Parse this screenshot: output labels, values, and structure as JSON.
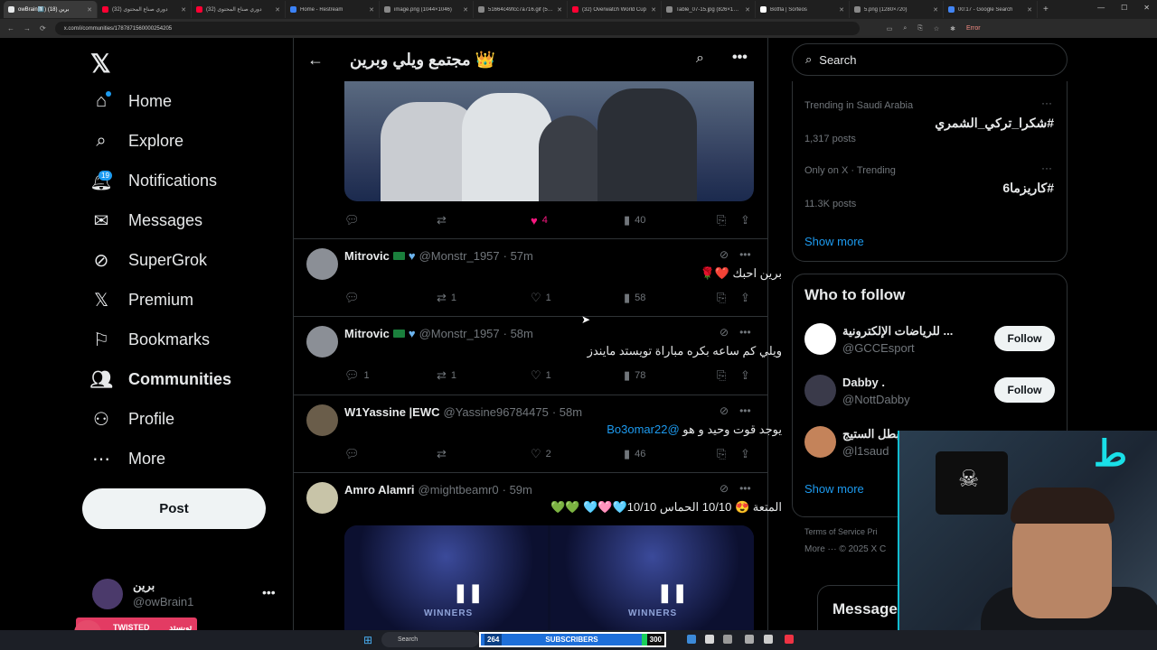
{
  "browser": {
    "tabs": [
      {
        "title": "owBrain1️⃣) برين (18)",
        "active": true,
        "color": "#e7e9ea"
      },
      {
        "title": "(32) دوري صناع المحتوى",
        "active": false,
        "color": "#ff0033"
      },
      {
        "title": "(32) دوري صناع المحتوى",
        "active": false,
        "color": "#ff0033"
      },
      {
        "title": "Home - Restream",
        "active": false,
        "color": "#3b82f6"
      },
      {
        "title": "image.png (1044×1046)",
        "active": false,
        "color": "#888888"
      },
      {
        "title": "51664c49fcc7a716.gif (51...",
        "active": false,
        "color": "#888888"
      },
      {
        "title": "(32) Overwatch World Cup",
        "active": false,
        "color": "#ff0033"
      },
      {
        "title": "Table_07-15.jpg (826×104...",
        "active": false,
        "color": "#888888"
      },
      {
        "title": "Botfla | Sorteos",
        "active": false,
        "color": "#ffffff"
      },
      {
        "title": "5.png (1280×720)",
        "active": false,
        "color": "#888888"
      },
      {
        "title": "00:17 - Google Search",
        "active": false,
        "color": "#4285f4"
      }
    ],
    "url": "x.com/i/communities/1787871560000254205",
    "profile_label": "Error"
  },
  "nav": {
    "items": [
      {
        "label": "Home",
        "icon": "home-icon"
      },
      {
        "label": "Explore",
        "icon": "search-icon"
      },
      {
        "label": "Notifications",
        "icon": "bell-icon"
      },
      {
        "label": "Messages",
        "icon": "envelope-icon"
      },
      {
        "label": "SuperGrok",
        "icon": "grok-icon"
      },
      {
        "label": "Premium",
        "icon": "x-icon"
      },
      {
        "label": "Bookmarks",
        "icon": "bookmark-icon"
      },
      {
        "label": "Communities",
        "icon": "people-icon"
      },
      {
        "label": "Profile",
        "icon": "person-icon"
      },
      {
        "label": "More",
        "icon": "more-circle-icon"
      }
    ],
    "notifications_badge": "19",
    "post_label": "Post",
    "account": {
      "name": "برين",
      "handle": "@owBrain1"
    }
  },
  "community": {
    "title": "مجتمع ويلي وبرين 👑"
  },
  "post0_actions": {
    "replies": "",
    "reposts": "",
    "likes": "4",
    "views": "40"
  },
  "posts": [
    {
      "name": "Mitrovic",
      "handle": "@Monstr_1957",
      "time": "· 57m",
      "text": "برين احبك ❤️🌹",
      "link": "",
      "replies": "",
      "reposts": "1",
      "likes": "1",
      "views": "58"
    },
    {
      "name": "Mitrovic",
      "handle": "@Monstr_1957",
      "time": "· 58m",
      "text": "ويلي كم ساعه بكره مباراة تويستد مايندز",
      "link": "",
      "replies": "1",
      "reposts": "1",
      "likes": "1",
      "views": "78"
    },
    {
      "name": "W1Yassine |EWC",
      "handle": "@Yassine96784475",
      "time": "· 58m",
      "text": "يوجد قوت وحيد و هو",
      "link": "@Bo3omar22",
      "replies": "",
      "reposts": "",
      "likes": "2",
      "views": "46"
    },
    {
      "name": "Amro Alamri",
      "handle": "@mightbeamr0",
      "time": "· 59m",
      "text": "المتعة 😍 10/10 الحماس 10/10🩵🩷🩵 💚💚",
      "link": "",
      "replies": "",
      "reposts": "",
      "likes": "",
      "views": ""
    }
  ],
  "media2": {
    "overlay": "WINNERS"
  },
  "right": {
    "search_placeholder": "Search",
    "trends": [
      {
        "meta": "Trending in Saudi Arabia",
        "tag": "#شكرا_تركي_الشمري",
        "count": "1,317 posts"
      },
      {
        "meta": "Only on X · Trending",
        "tag": "#كاريزما6",
        "count": "11.3K posts"
      }
    ],
    "show_more": "Show more",
    "who_to_follow_title": "Who to follow",
    "who_to_follow": [
      {
        "name": "للرياضات الإلكترونية ...",
        "handle": "@GCCEsport",
        "follow": "Follow",
        "avatar_color": "#ffffff"
      },
      {
        "name": "Dabby .",
        "handle": "@NottDabby",
        "follow": "Follow",
        "avatar_color": "#3a3a4a"
      },
      {
        "name": "بطل الستيج",
        "handle": "@l1saud",
        "follow": "",
        "avatar_color": "#c4835a"
      }
    ],
    "footer_links": "Terms of Service   Pri",
    "footer_more": "More ···  © 2025 X C",
    "messages_dock": "Message"
  },
  "stream": {
    "team_name_en": "TWISTED MINDS",
    "team_name_ar": "تويستد مايندز",
    "subscribers_count": "264",
    "subscribers_label": "SUBSCRIBERS",
    "subscribers_goal": "300",
    "taskbar_search": "Search"
  },
  "colors": {
    "accent": "#1d9bf0",
    "like": "#f91880",
    "background": "#000000"
  }
}
